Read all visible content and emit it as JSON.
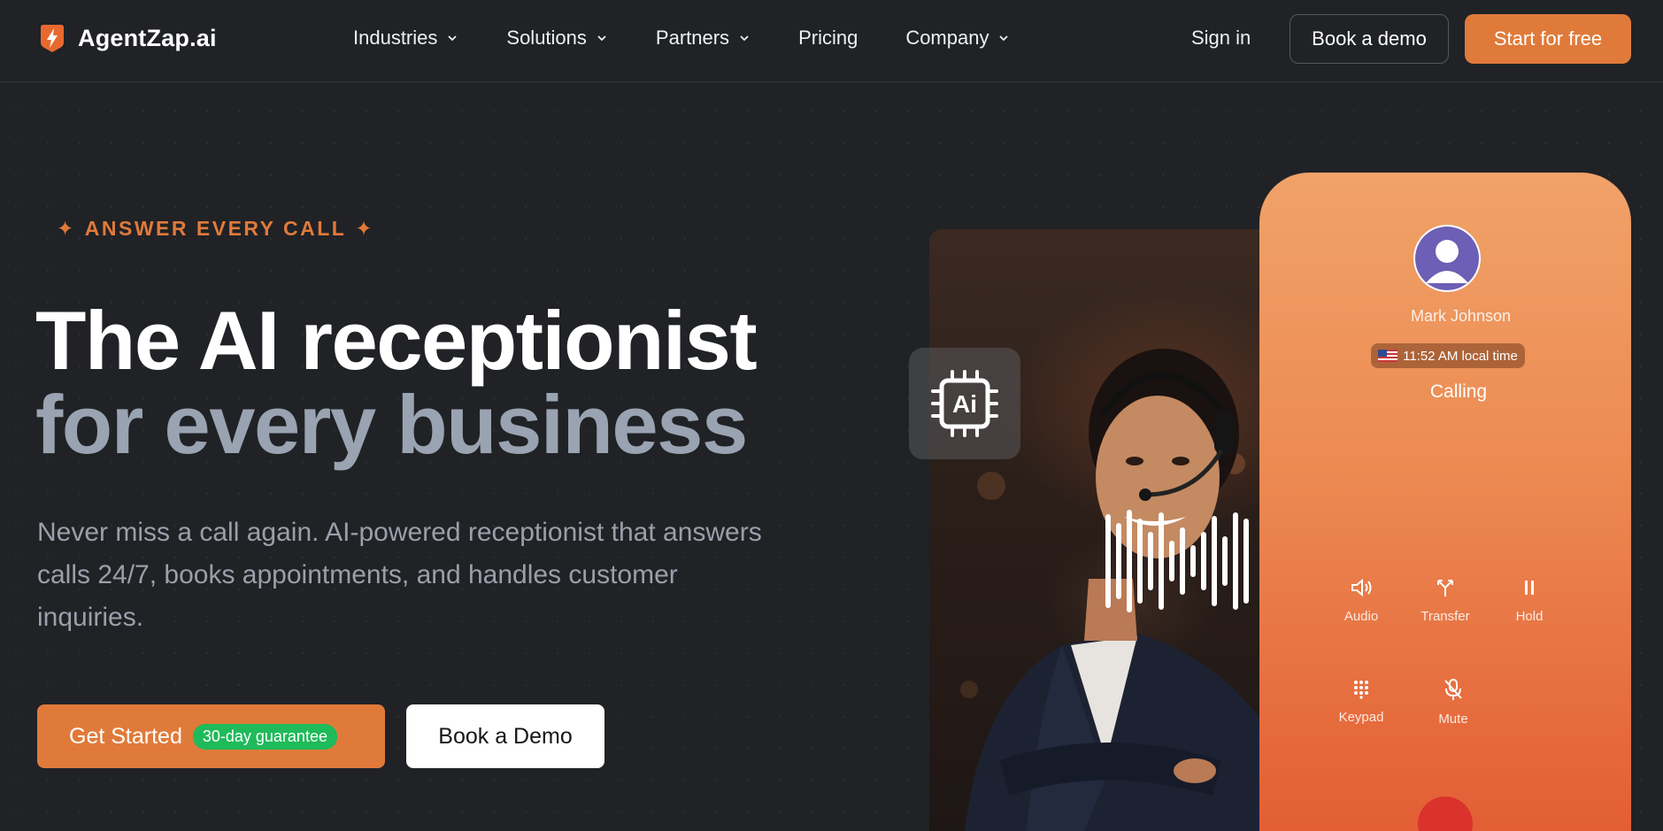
{
  "nav": {
    "brand": "AgentZap.ai",
    "items": [
      {
        "label": "Industries",
        "dropdown": true
      },
      {
        "label": "Solutions",
        "dropdown": true
      },
      {
        "label": "Partners",
        "dropdown": true
      },
      {
        "label": "Pricing",
        "dropdown": false
      },
      {
        "label": "Company",
        "dropdown": true
      }
    ],
    "sign_in": "Sign in",
    "book_demo": "Book a demo",
    "start_free": "Start for free"
  },
  "hero": {
    "eyebrow": "ANSWER EVERY CALL",
    "eyebrow_icon": "sparkle-icon",
    "title_line1": "The AI receptionist",
    "title_line2": "for every business",
    "lead": "Never miss a call again. AI-powered receptionist that answers calls 24/7, books appointments, and handles customer inquiries.",
    "cta_primary": "Get Started",
    "cta_badge": "30-day guarantee",
    "cta_secondary": "Book a Demo"
  },
  "visual": {
    "ai_chip_label": "Ai",
    "phone": {
      "caller_name": "Mark Johnson",
      "local_time": "11:52 AM local time",
      "status": "Calling",
      "controls": [
        {
          "label": "Audio",
          "icon": "speaker-icon"
        },
        {
          "label": "Transfer",
          "icon": "transfer-icon"
        },
        {
          "label": "Hold",
          "icon": "pause-icon"
        },
        {
          "label": "Keypad",
          "icon": "keypad-icon"
        },
        {
          "label": "Mute",
          "icon": "mic-off-icon"
        }
      ]
    }
  },
  "colors": {
    "accent": "#e07a3a",
    "background": "#202226",
    "badge_green": "#1fba5a",
    "muted_title": "#9aa3b1"
  }
}
